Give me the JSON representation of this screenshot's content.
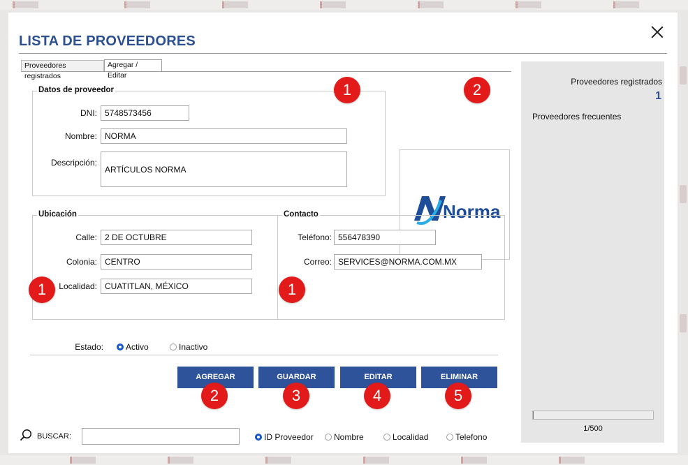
{
  "window": {
    "title": "LISTA DE PROVEEDORES"
  },
  "tabs": [
    {
      "label": "Proveedores registrados"
    },
    {
      "label": "Agregar / Editar"
    }
  ],
  "datos": {
    "title": "Datos de proveedor",
    "dni_label": "DNI:",
    "dni_value": "5748573456",
    "nombre_label": "Nombre:",
    "nombre_value": "NORMA",
    "descripcion_label": "Descripción:",
    "descripcion_value": "ARTÍCULOS NORMA"
  },
  "logo": {
    "text": "Norma",
    "colors": {
      "primary": "#1e4d9a",
      "accent": "#29aee6"
    }
  },
  "ubicacion": {
    "title": "Ubicación",
    "calle_label": "Calle:",
    "calle_value": "2 DE OCTUBRE",
    "colonia_label": "Colonia:",
    "colonia_value": "CENTRO",
    "localidad_label": "Localidad:",
    "localidad_value": "CUATITLAN, MÉXICO"
  },
  "contacto": {
    "title": "Contacto",
    "telefono_label": "Teléfono:",
    "telefono_value": "556478390",
    "correo_label": "Correo:",
    "correo_value": "SERVICES@NORMA.COM.MX"
  },
  "estado": {
    "label": "Estado:",
    "options": [
      "Activo",
      "Inactivo"
    ],
    "selected": "Activo"
  },
  "buttons": {
    "agregar": "AGREGAR",
    "guardar": "GUARDAR",
    "editar": "EDITAR",
    "eliminar": "ELIMINAR"
  },
  "badges": {
    "datos": "1",
    "logo": "2",
    "ubicacion": "1",
    "contacto": "1",
    "agregar": "2",
    "guardar": "3",
    "editar": "4",
    "eliminar": "5"
  },
  "stats": {
    "registrados_label": "Proveedores registrados",
    "registrados_count": "1",
    "frecuentes_label": "Proveedores frecuentes",
    "progress_text": "1/500",
    "progress_fraction": 0.002
  },
  "search": {
    "label": "BUSCAR:",
    "value": "",
    "options": [
      "ID Proveedor",
      "Nombre",
      "Localidad",
      "Telefono"
    ],
    "selected": "ID Proveedor"
  },
  "colors": {
    "title": "#2c4f8f",
    "button": "#2f539a",
    "badge": "#e21a1a",
    "radio_selected": "#1456c8"
  }
}
